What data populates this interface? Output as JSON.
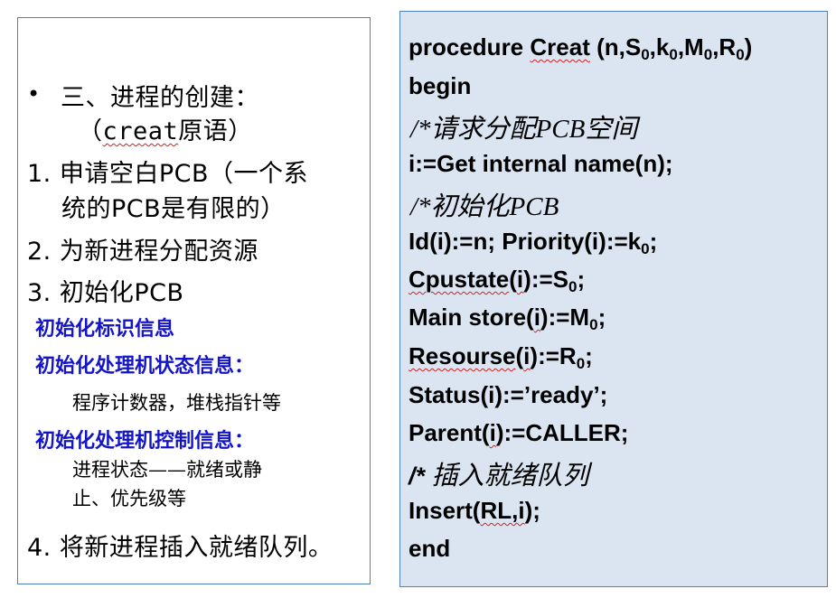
{
  "left": {
    "bullet": "•",
    "heading": "三、进程的创建：",
    "subheading_open": "（",
    "subheading_word": "creat",
    "subheading_rest": "原语）",
    "step1_line1": "1. 申请空白PCB（一个系",
    "step1_line2": "统的PCB是有限的）",
    "step2": "2. 为新进程分配资源",
    "step3": "3. 初始化PCB",
    "sub_a": "初始化标识信息",
    "sub_b": "初始化处理机状态信息：",
    "sub_b_detail": "程序计数器，堆栈指针等",
    "sub_c": "初始化处理机控制信息：",
    "sub_c_detail1": "进程状态——就绪或静",
    "sub_c_detail2": "止、优先级等",
    "step4": "4. 将新进程插入就绪队列。"
  },
  "code": {
    "proc_kw": "procedure ",
    "proc_name": "Creat",
    "proc_open": " (n,S",
    "s0": "0",
    "k": ",k",
    "k0": "0",
    "m": ",M",
    "m0": "0",
    "r": ",R",
    "r0": "0",
    "proc_close": ")",
    "begin": "begin",
    "comment1": "/*请求分配PCB空间",
    "line_get": "i:=Get internal name(n);",
    "comment2": "/*初始化PCB",
    "line_id": "Id(i):=n;   Priority(i):=k",
    "line_id_sub": "0",
    "line_id_end": ";",
    "cpustate_word": "Cpustate",
    "cpustate_open": "(",
    "cpustate_i": "i",
    "cpustate_rest": "):=S",
    "cpustate_sub": "0",
    "cpustate_end": ";",
    "main_a": "Main store(",
    "main_i": "i",
    "main_b": "):=M",
    "main_sub": "0",
    "main_end": ";",
    "res_word": "Resourse",
    "res_open": "(",
    "res_i": "i",
    "res_b": "):=R",
    "res_sub": "0",
    "res_end": ";",
    "line_status": "Status(i):=’ready’;",
    "parent_a": "Parent(",
    "parent_i": "i",
    "parent_b": "):=CALLER;",
    "comment3_mark": "/* ",
    "comment3_text": "插入就绪队列",
    "insert_a": "Insert(",
    "insert_b": "RL,i",
    "insert_c": ");",
    "end": "end"
  },
  "colors": {
    "border": "#4f81bd",
    "code_bg": "#dbe5f1",
    "blue_text": "#1414c8",
    "squiggle": "#d02020"
  }
}
